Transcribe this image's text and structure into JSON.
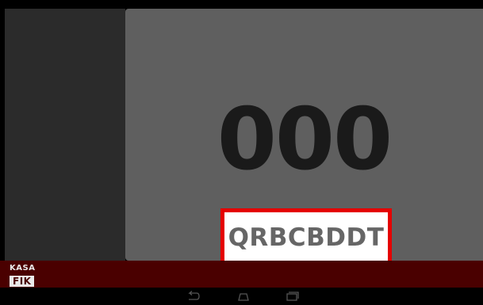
{
  "display": {
    "counter": "000",
    "code": "QRBCBDDT"
  },
  "logo": {
    "line1": "KASA",
    "line2": "FIK"
  },
  "navbar": {
    "back_icon": "back-icon",
    "home_icon": "home-icon",
    "recent_icon": "recent-apps-icon"
  },
  "colors": {
    "main_panel": "#5f5f5f",
    "left_panel": "#2b2b2b",
    "footer": "#4a0000",
    "code_border": "#e50000"
  }
}
